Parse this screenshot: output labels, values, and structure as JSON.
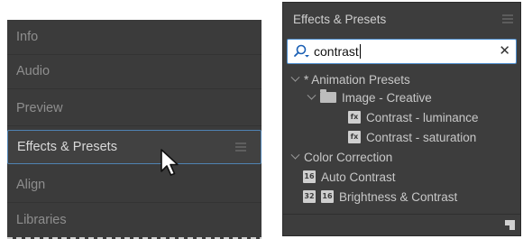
{
  "left_panel": {
    "items": [
      {
        "label": "Info"
      },
      {
        "label": "Audio"
      },
      {
        "label": "Preview"
      },
      {
        "label": "Effects & Presets",
        "active": true
      },
      {
        "label": "Align"
      },
      {
        "label": "Libraries"
      }
    ]
  },
  "effects_panel": {
    "title": "Effects & Presets",
    "search": {
      "value": "contrast"
    },
    "tree": [
      {
        "label": "* Animation Presets",
        "kind": "category",
        "expanded": true
      },
      {
        "label": "Image - Creative",
        "kind": "folder",
        "expanded": true
      },
      {
        "label": "Contrast - luminance",
        "kind": "preset",
        "badge": "fx"
      },
      {
        "label": "Contrast - saturation",
        "kind": "preset",
        "badge": "fx"
      },
      {
        "label": "Color Correction",
        "kind": "category",
        "expanded": true
      },
      {
        "label": "Auto Contrast",
        "kind": "effect",
        "badge": "16"
      },
      {
        "label": "Brightness & Contrast",
        "kind": "effect",
        "badge": "32"
      }
    ]
  },
  "colors": {
    "panel_bg": "#3b3b3b",
    "focus_blue": "#4f83b3"
  },
  "icons": {
    "panel_menu": "hamburger-menu-icon",
    "search": "search-icon",
    "clear": "close-icon",
    "cursor": "mouse-pointer-icon",
    "new_item": "new-item-icon"
  }
}
